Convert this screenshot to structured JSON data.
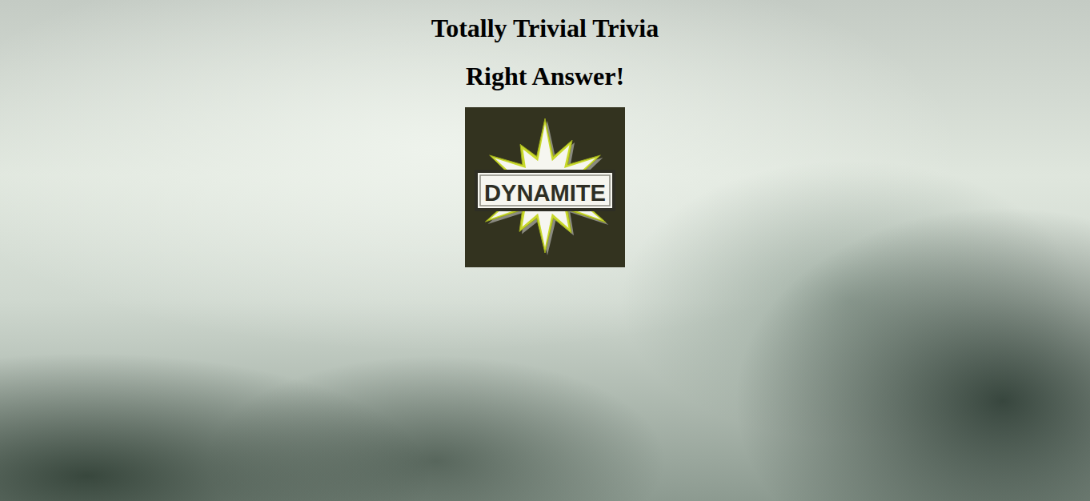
{
  "page": {
    "title": "Totally Trivial Trivia",
    "result": "Right Answer!"
  },
  "logo": {
    "text": "DYNAMITE"
  }
}
